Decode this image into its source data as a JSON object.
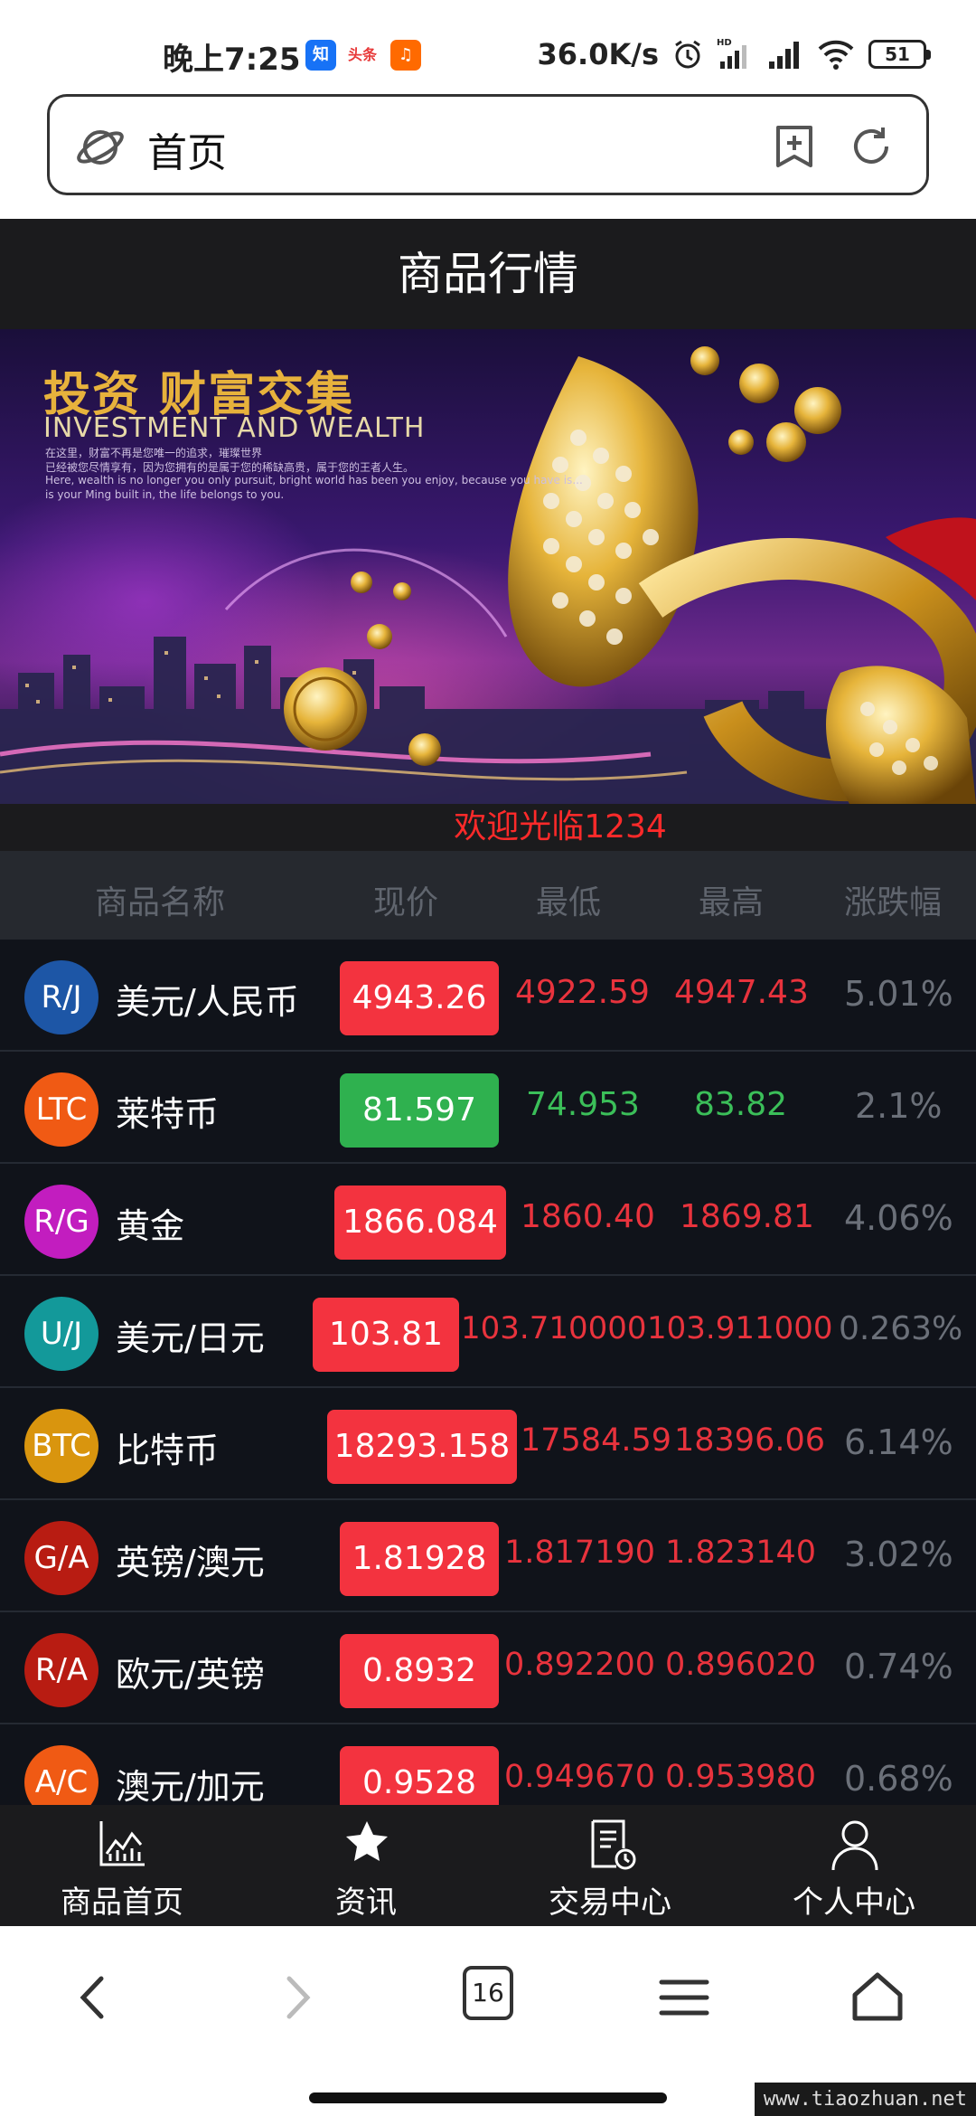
{
  "status_bar": {
    "time": "晚上7:25",
    "apps": [
      {
        "name": "zhihu-icon",
        "text": "知",
        "color": "#1772f6"
      },
      {
        "name": "toutiao-icon",
        "text": "头条",
        "color": "#e83a3a"
      },
      {
        "name": "taobao-icon",
        "text": "♫",
        "color": "#ff6a00"
      }
    ],
    "net_speed": "36.0K/s",
    "battery": "51"
  },
  "url_bar": {
    "text": "首页"
  },
  "header": {
    "title": "商品行情"
  },
  "banner": {
    "title": "投资 财富交集",
    "subtitle": "INVESTMENT AND WEALTH",
    "line1": "在这里，财富不再是您唯一的追求，璀璨世界",
    "line2": "已经被您尽情享有，因为您拥有的是属于您的稀缺高贵，属于您的王者人生。",
    "line3": "Here, wealth is no longer you only pursuit, bright world has been you enjoy, because you have is...",
    "line4": "is your Ming built in, the life belongs to you."
  },
  "welcome": "欢迎光临1234",
  "table": {
    "headers": [
      "商品名称",
      "现价",
      "最低",
      "最高",
      "涨跌幅"
    ],
    "rows": [
      {
        "code": "R/J",
        "name": "美元/人民币",
        "price": "4943.26",
        "low": "4922.59",
        "high": "4947.43",
        "change": "5.01%",
        "trend": "up",
        "avatar_color": "#1d56a6"
      },
      {
        "code": "LTC",
        "name": "莱特币",
        "price": "81.597",
        "low": "74.953",
        "high": "83.82",
        "change": "2.1%",
        "trend": "down",
        "avatar_color": "#f05a14"
      },
      {
        "code": "R/G",
        "name": "黄金",
        "price": "1866.084",
        "low": "1860.40",
        "high": "1869.81",
        "change": "4.06%",
        "trend": "up",
        "avatar_color": "#c21dbf"
      },
      {
        "code": "U/J",
        "name": "美元/日元",
        "price": "103.81",
        "low": "103.710000",
        "high": "103.911000",
        "change": "0.263%",
        "trend": "up",
        "avatar_color": "#13999a"
      },
      {
        "code": "BTC",
        "name": "比特币",
        "price": "18293.158",
        "low": "17584.59",
        "high": "18396.06",
        "change": "6.14%",
        "trend": "up",
        "avatar_color": "#d9950e"
      },
      {
        "code": "G/A",
        "name": "英镑/澳元",
        "price": "1.81928",
        "low": "1.817190",
        "high": "1.823140",
        "change": "3.02%",
        "trend": "up",
        "avatar_color": "#b81c12"
      },
      {
        "code": "R/A",
        "name": "欧元/英镑",
        "price": "0.8932",
        "low": "0.892200",
        "high": "0.896020",
        "change": "0.74%",
        "trend": "up",
        "avatar_color": "#b81c12"
      },
      {
        "code": "A/C",
        "name": "澳元/加元",
        "price": "0.9528",
        "low": "0.949670",
        "high": "0.953980",
        "change": "0.68%",
        "trend": "up",
        "avatar_color": "#f05a14"
      }
    ]
  },
  "bottom_nav": {
    "items": [
      {
        "label": "商品首页",
        "icon": "chart-icon"
      },
      {
        "label": "资讯",
        "icon": "star-icon"
      },
      {
        "label": "交易中心",
        "icon": "document-clock-icon"
      },
      {
        "label": "个人中心",
        "icon": "user-icon"
      }
    ]
  },
  "browser_bar": {
    "tab_count": "16"
  },
  "watermark": "www.tiaozhuan.net"
}
